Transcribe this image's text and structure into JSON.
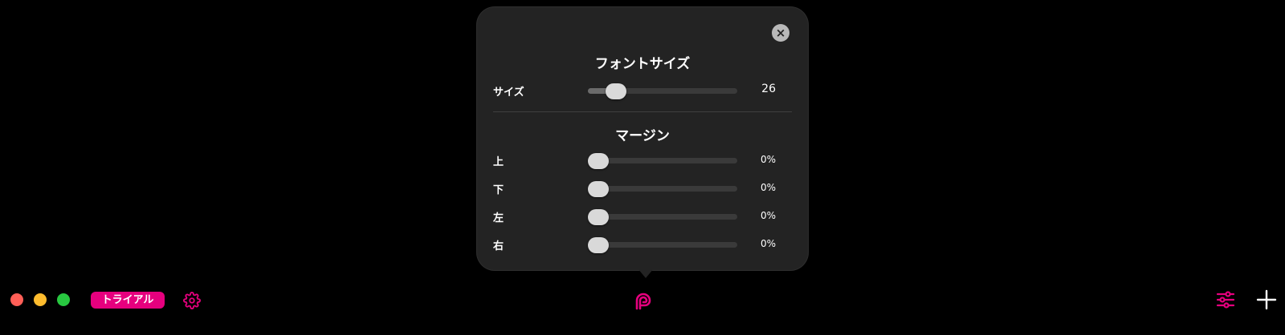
{
  "popover": {
    "close_glyph": "×",
    "font_section": {
      "title": "フォントサイズ",
      "size": {
        "label": "サイズ",
        "value_text": "26",
        "level_fraction": 0.14
      }
    },
    "margin_section": {
      "title": "マージン",
      "rows": [
        {
          "label": "上",
          "value_text": "0%",
          "level_fraction": 0
        },
        {
          "label": "下",
          "value_text": "0%",
          "level_fraction": 0
        },
        {
          "label": "左",
          "value_text": "0%",
          "level_fraction": 0
        },
        {
          "label": "右",
          "value_text": "0%",
          "level_fraction": 0
        }
      ]
    }
  },
  "toolbar": {
    "traffic_lights": {
      "close": "#ff5f57",
      "minimize": "#febc2e",
      "zoom": "#28c840"
    },
    "trial_label": "トライアル",
    "accent_color": "#e6007e",
    "icons": {
      "settings": "gear-icon",
      "center": "app-logo-icon",
      "adjust": "sliders-icon",
      "add": "plus-icon"
    }
  }
}
